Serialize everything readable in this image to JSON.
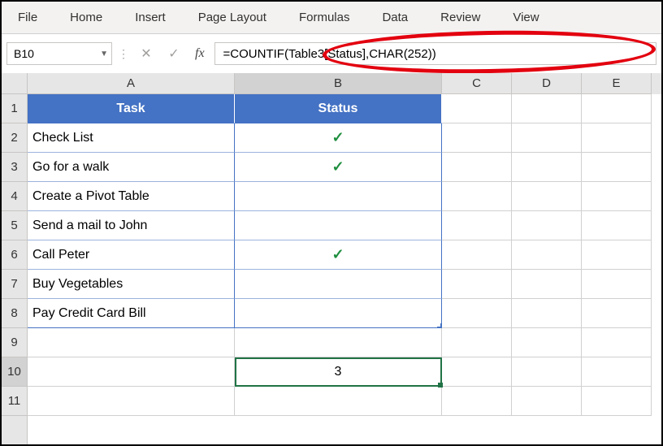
{
  "ribbon": {
    "tabs": [
      "File",
      "Home",
      "Insert",
      "Page Layout",
      "Formulas",
      "Data",
      "Review",
      "View"
    ]
  },
  "nameBox": {
    "value": "B10"
  },
  "formulaBar": {
    "fx": "fx",
    "formula": "=COUNTIF(Table3[Status],CHAR(252))"
  },
  "columns": [
    "A",
    "B",
    "C",
    "D",
    "E"
  ],
  "rowNumbers": [
    "1",
    "2",
    "3",
    "4",
    "5",
    "6",
    "7",
    "8",
    "9",
    "10",
    "11"
  ],
  "table": {
    "headers": {
      "task": "Task",
      "status": "Status"
    },
    "rows": [
      {
        "task": "Check List",
        "status": "✓"
      },
      {
        "task": "Go for a walk",
        "status": "✓"
      },
      {
        "task": "Create a Pivot Table",
        "status": ""
      },
      {
        "task": "Send a mail to John",
        "status": ""
      },
      {
        "task": "Call Peter",
        "status": "✓"
      },
      {
        "task": "Buy Vegetables",
        "status": ""
      },
      {
        "task": "Pay Credit Card Bill",
        "status": ""
      }
    ]
  },
  "result": {
    "value": "3"
  }
}
